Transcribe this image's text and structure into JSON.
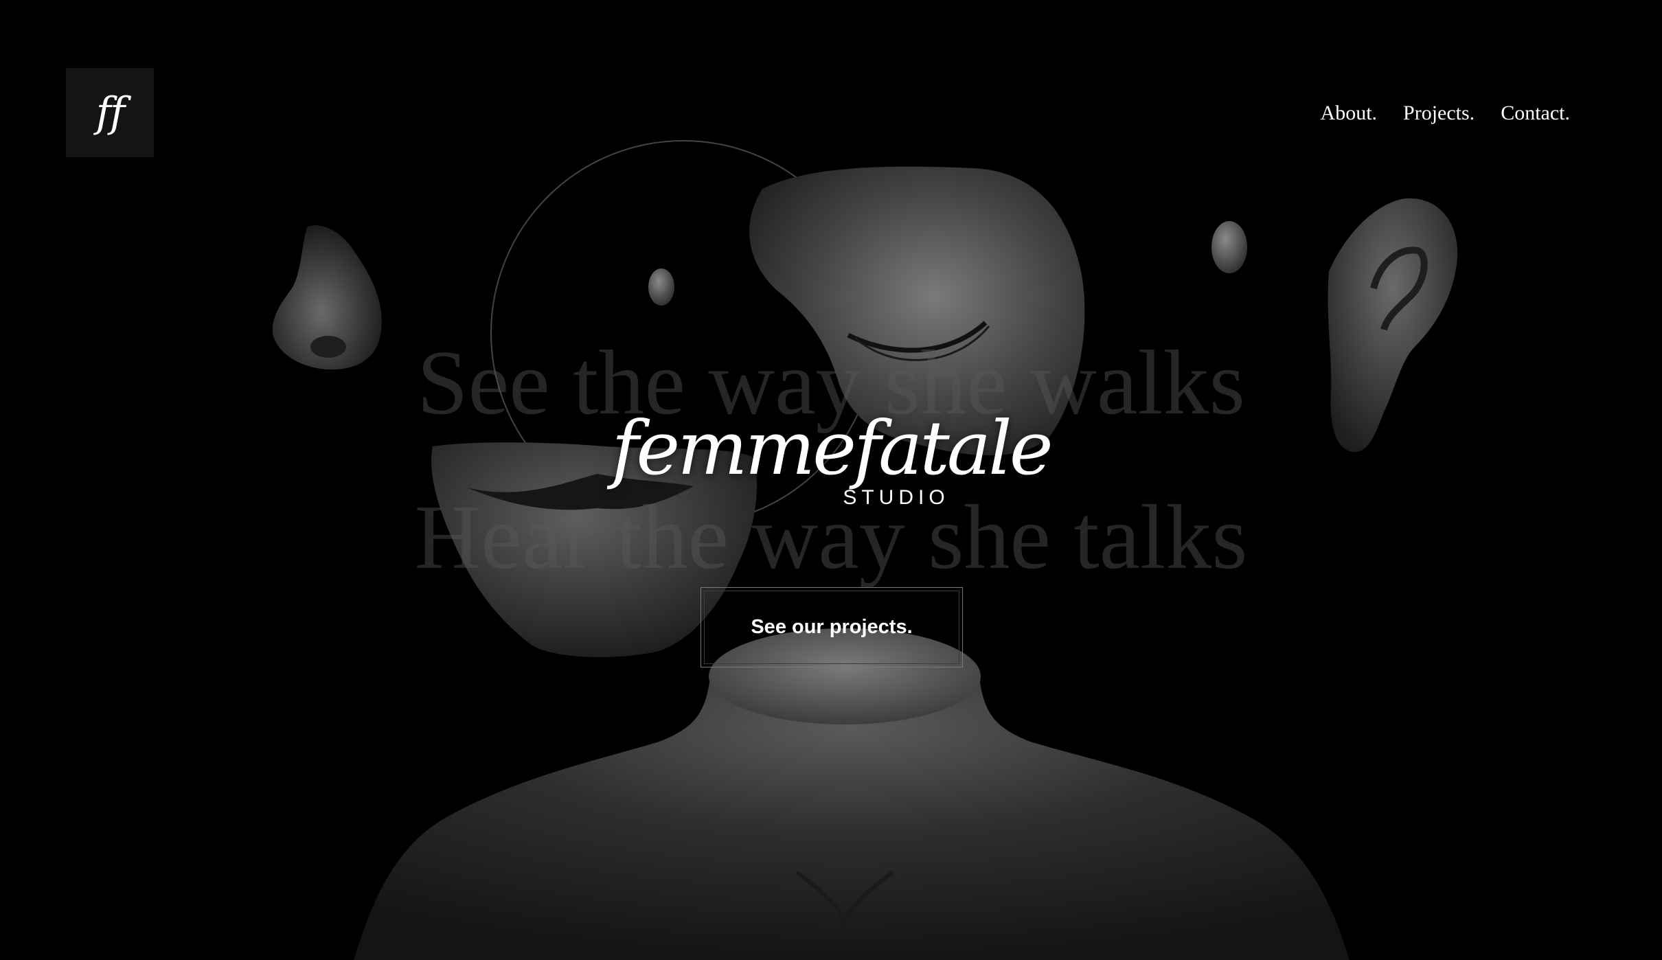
{
  "logo": {
    "monogram": "ff"
  },
  "nav": {
    "about": "About.",
    "projects": "Projects.",
    "contact": "Contact."
  },
  "hero": {
    "line1": "See the way she walks",
    "line2": "Hear the way she talks",
    "brand": "femmefatale",
    "brand_sub": "STUDIO",
    "cta": "See our projects."
  },
  "colors": {
    "background": "#000000",
    "text": "#ffffff",
    "tagline": "#3a3a3a",
    "cta_border": "#7a7a7a"
  }
}
